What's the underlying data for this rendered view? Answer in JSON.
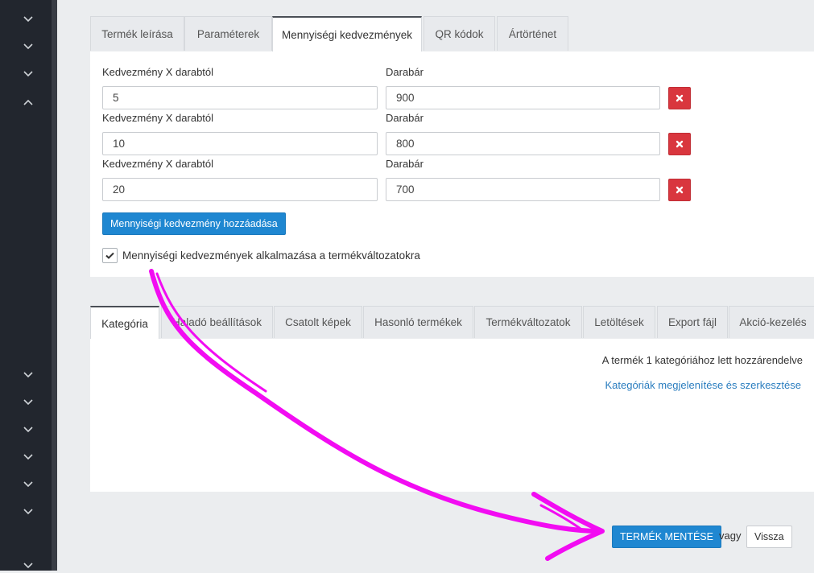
{
  "sidebar": {
    "icons": [
      "chevron-down-icon",
      "chevron-down-icon",
      "chevron-down-icon",
      "chevron-up-icon",
      "chevron-down-icon",
      "chevron-down-icon",
      "chevron-down-icon",
      "chevron-down-icon",
      "chevron-down-icon",
      "chevron-down-icon",
      "chevron-down-icon"
    ]
  },
  "top_tabs": [
    "Termék leírása",
    "Paraméterek",
    "Mennyiségi kedvezmények",
    "QR kódok",
    "Ártörténet"
  ],
  "discounts": {
    "qty_label": "Kedvezmény X darabtól",
    "price_label": "Darabár",
    "rows": [
      {
        "qty": "5",
        "price": "900"
      },
      {
        "qty": "10",
        "price": "800"
      },
      {
        "qty": "20",
        "price": "700"
      }
    ],
    "add_label": "Mennyiségi kedvezmény hozzáadása",
    "apply_variants_label": "Mennyiségi kedvezmények alkalmazása a termékváltozatokra",
    "apply_variants_checked": true
  },
  "bottom_tabs": [
    "Kategória",
    "Haladó beállítások",
    "Csatolt képek",
    "Hasonló termékek",
    "Termékváltozatok",
    "Letöltések",
    "Export fájl",
    "Akció-kezelés"
  ],
  "category": {
    "assigned_text": "A termék 1 kategóriához lett hozzárendelve",
    "link_text": "Kategóriák megjelenítése és szerkesztése"
  },
  "footer": {
    "save_label": "TERMÉK MENTÉSE",
    "or_text": "vagy",
    "back_label": "Vissza"
  },
  "colors": {
    "accent": "#1f87d1",
    "danger": "#d9363e",
    "annotation": "#f20cf2"
  }
}
